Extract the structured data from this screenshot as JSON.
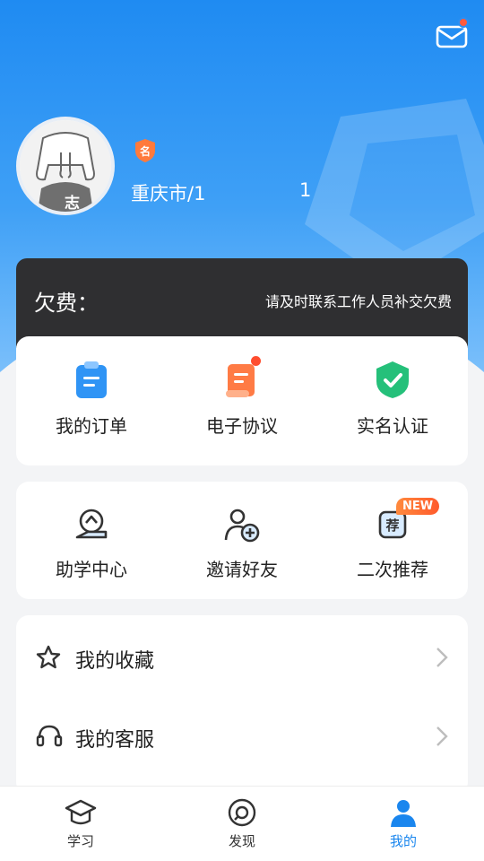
{
  "header": {
    "mail_icon": "mail-icon",
    "has_unread": true
  },
  "profile": {
    "avatar_text": "志",
    "badge_text": "名",
    "username": "",
    "city": "重庆市/1",
    "city_suffix": "1"
  },
  "debt": {
    "label": "欠费：",
    "amount": "",
    "note": "请及时联系工作人员补交欠费"
  },
  "services": [
    {
      "label": "我的订单",
      "icon": "order-icon"
    },
    {
      "label": "电子协议",
      "icon": "agreement-icon"
    },
    {
      "label": "实名认证",
      "icon": "verified-shield-icon"
    }
  ],
  "tools": [
    {
      "label": "助学中心",
      "icon": "study-help-icon"
    },
    {
      "label": "邀请好友",
      "icon": "invite-friend-icon"
    },
    {
      "label": "二次推荐",
      "icon": "recommend-icon",
      "tag": "NEW"
    }
  ],
  "menu": [
    {
      "label": "我的收藏",
      "icon": "star-icon"
    },
    {
      "label": "我的客服",
      "icon": "headset-icon"
    }
  ],
  "tabbar": [
    {
      "label": "学习",
      "icon": "graduation-cap-icon",
      "active": false
    },
    {
      "label": "发现",
      "icon": "compass-icon",
      "active": false
    },
    {
      "label": "我的",
      "icon": "user-icon",
      "active": true
    }
  ],
  "colors": {
    "primary": "#1a86ee",
    "debt_amount": "#ff3b1f",
    "badge": "#ff7a3c"
  }
}
